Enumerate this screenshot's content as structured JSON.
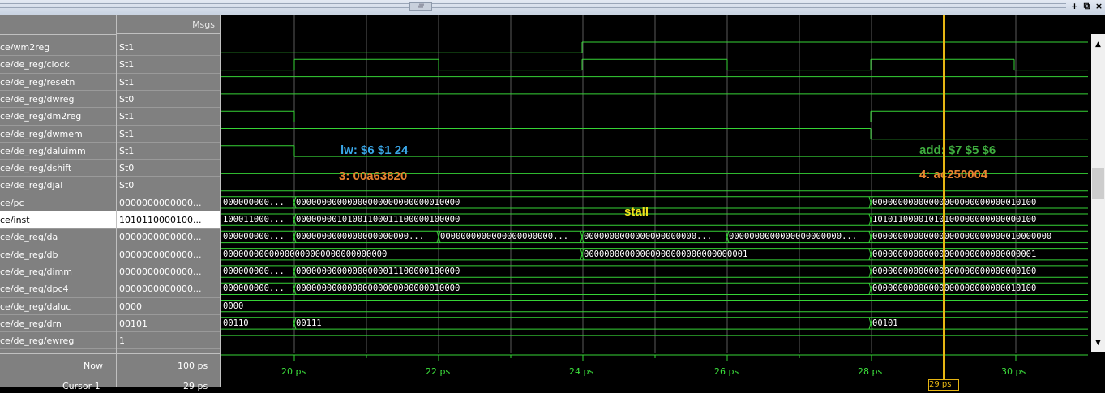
{
  "window": {
    "grip_text": "//////",
    "buttons": [
      "+",
      "⧉",
      "×"
    ]
  },
  "header": {
    "msgs_label": "Msgs"
  },
  "signals": [
    {
      "name": "ce/wm2reg",
      "value": "St1"
    },
    {
      "name": "ce/de_reg/clock",
      "value": "St1"
    },
    {
      "name": "ce/de_reg/resetn",
      "value": "St1"
    },
    {
      "name": "ce/de_reg/dwreg",
      "value": "St0"
    },
    {
      "name": "ce/de_reg/dm2reg",
      "value": "St1"
    },
    {
      "name": "ce/de_reg/dwmem",
      "value": "St1"
    },
    {
      "name": "ce/de_reg/daluimm",
      "value": "St1"
    },
    {
      "name": "ce/de_reg/dshift",
      "value": "St0"
    },
    {
      "name": "ce/de_reg/djal",
      "value": "St0"
    },
    {
      "name": "ce/pc",
      "value": "0000000000000..."
    },
    {
      "name": "ce/inst",
      "value": "1010110000100..."
    },
    {
      "name": "ce/de_reg/da",
      "value": "0000000000000..."
    },
    {
      "name": "ce/de_reg/db",
      "value": "0000000000000..."
    },
    {
      "name": "ce/de_reg/dimm",
      "value": "0000000000000..."
    },
    {
      "name": "ce/de_reg/dpc4",
      "value": "0000000000000..."
    },
    {
      "name": "ce/de_reg/daluc",
      "value": "0000"
    },
    {
      "name": "ce/de_reg/drn",
      "value": "00101"
    },
    {
      "name": "ce/de_reg/ewreg",
      "value": "1"
    }
  ],
  "selected_row": 10,
  "bus_labels": {
    "pc": [
      "000000000...",
      "00000000000000000000000000010000",
      "00000000000000000000000000010100"
    ],
    "inst": [
      "100011000...",
      "00000000101001100011100000100000",
      "10101100001010100000000000000100"
    ],
    "da": [
      "000000000...",
      "0000000000000000000000...",
      "0000000000000000000000...",
      "0000000000000000000000...",
      "0000000000000000000000...",
      "00000000000000000000000000010000000"
    ],
    "db": [
      "00000000000000000000000000000000",
      "00000000000000000000000000000001",
      "00000000000000000000000000000001"
    ],
    "dimm": [
      "000000000...",
      "00000000000000000011100000100000",
      "00000000000000000000000000000100"
    ],
    "dpc4": [
      "000000000...",
      "00000000000000000000000000010000",
      "00000000000000000000000000010100"
    ],
    "daluc": [
      "0000"
    ],
    "drn": [
      "00110",
      "00111",
      "00101"
    ]
  },
  "annotations": {
    "lw": "lw: $6 $1 24",
    "inst3": "3: 00a63820",
    "stall": "stall",
    "add": "add: $7 $5 $6",
    "inst4": "4: ac250004"
  },
  "annotation_colors": {
    "blue": "#3aa7e8",
    "orange": "#e8822f",
    "yellow": "#f2e21b",
    "green": "#3fae3f"
  },
  "bottom": {
    "now_label": "Now",
    "now_value": "100 ps",
    "cursor_label": "Cursor 1",
    "cursor_value": "29 ps",
    "cursor_box": "29 ps"
  },
  "timeline": {
    "ticks": [
      "20 ps",
      "22 ps",
      "24 ps",
      "26 ps",
      "28 ps",
      "30 ps"
    ]
  }
}
